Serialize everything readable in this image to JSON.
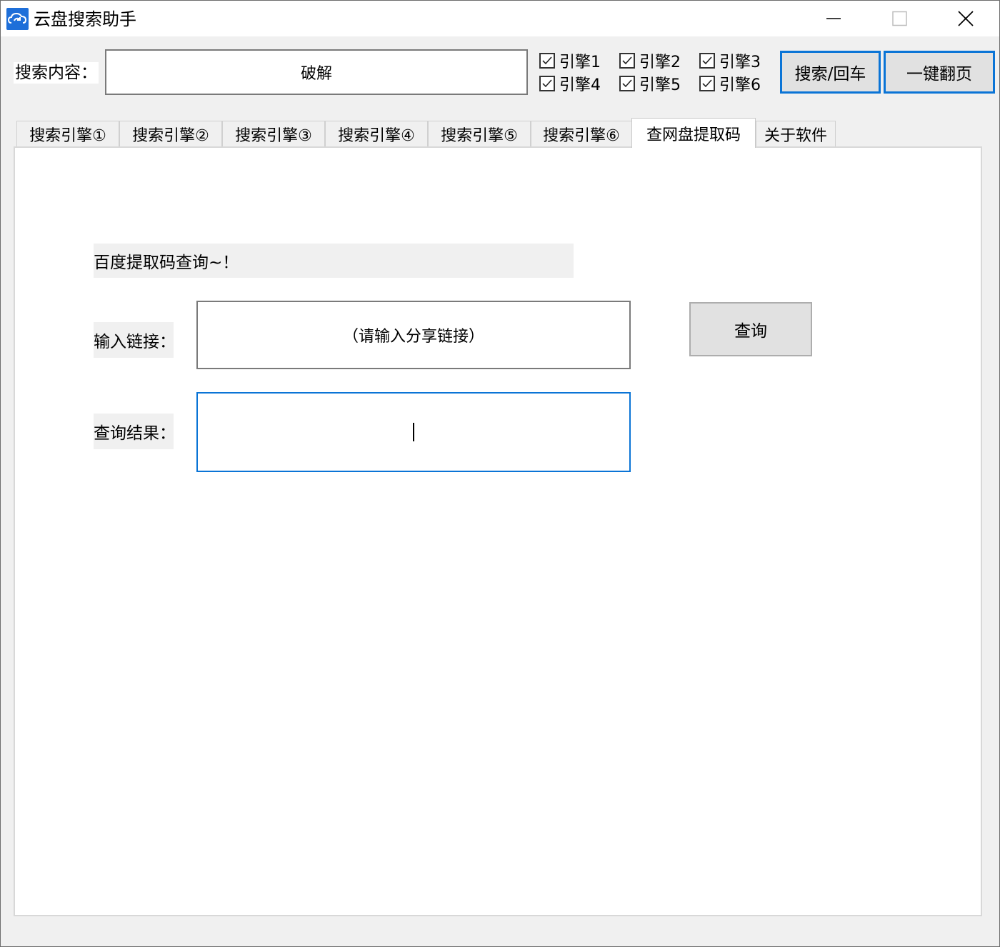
{
  "window": {
    "title": "云盘搜索助手",
    "icon": "cloud-refresh-icon",
    "controls": [
      "minimize-icon",
      "maximize-icon",
      "close-icon"
    ]
  },
  "search": {
    "label": "搜索内容：",
    "value": "破解"
  },
  "engines": [
    {
      "label": "引擎1",
      "checked": true
    },
    {
      "label": "引擎2",
      "checked": true
    },
    {
      "label": "引擎3",
      "checked": true
    },
    {
      "label": "引擎4",
      "checked": true
    },
    {
      "label": "引擎5",
      "checked": true
    },
    {
      "label": "引擎6",
      "checked": true
    }
  ],
  "buttons": {
    "search": "搜索/回车",
    "page": "一键翻页"
  },
  "tabs": [
    {
      "label": "搜索引擎①",
      "active": false
    },
    {
      "label": "搜索引擎②",
      "active": false
    },
    {
      "label": "搜索引擎③",
      "active": false
    },
    {
      "label": "搜索引擎④",
      "active": false
    },
    {
      "label": "搜索引擎⑤",
      "active": false
    },
    {
      "label": "搜索引擎⑥",
      "active": false
    },
    {
      "label": "查网盘提取码",
      "active": true
    },
    {
      "label": "关于软件",
      "active": false
    }
  ],
  "extract": {
    "heading": "百度提取码查询~！",
    "link_label": "输入链接：",
    "link_value": "（请输入分享链接）",
    "result_label": "查询结果：",
    "result_value": "",
    "query_button": "查询"
  },
  "colors": {
    "accent": "#0a74d6",
    "window_bg": "#f0f0f0",
    "panel_bg": "#ffffff",
    "button_bg": "#e1e1e1"
  }
}
